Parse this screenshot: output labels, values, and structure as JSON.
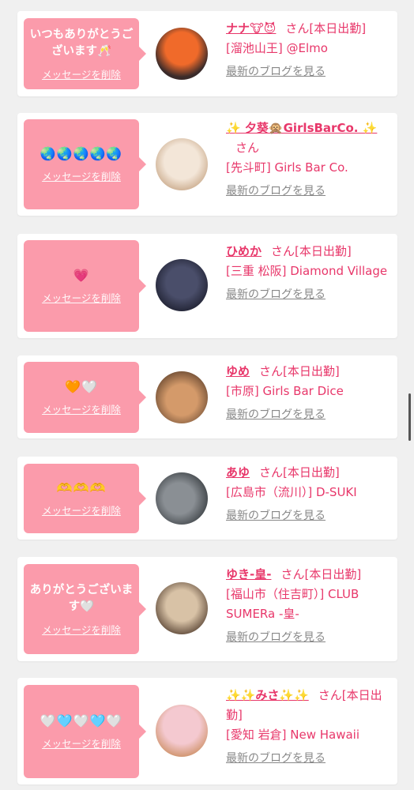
{
  "cards": [
    {
      "message": "いつもありがとうございます🥂",
      "delete_label": "メッセージを削除",
      "name": "ナナ🐮😈",
      "honorific": "さん",
      "status": "[本日出勤]",
      "shop": "[溜池山王] @Elmo",
      "blog_label": "最新のブログを見る",
      "avatar_colors": [
        "#f06a2a",
        "#3a2b2a"
      ]
    },
    {
      "message": "🌏🌏🌏🌏🌏",
      "delete_label": "メッセージを削除",
      "name": "✨ 夕葵🙊GirlsBarCo. ✨",
      "honorific": "さん",
      "status": "",
      "shop": "[先斗町] Girls Bar Co.",
      "blog_label": "最新のブログを見る",
      "avatar_colors": [
        "#f3e6d8",
        "#c9a98a"
      ]
    },
    {
      "message": "💗",
      "delete_label": "メッセージを削除",
      "name": "ひめか",
      "honorific": "さん",
      "status": "[本日出勤]",
      "shop": "[三重 松阪] Diamond Village",
      "blog_label": "最新のブログを見る",
      "avatar_colors": [
        "#4a4e6a",
        "#1e2030"
      ]
    },
    {
      "message": "🧡🤍",
      "delete_label": "メッセージを削除",
      "name": "ゆめ",
      "honorific": "さん",
      "status": "[本日出勤]",
      "shop": "[市原] Girls Bar Dice",
      "blog_label": "最新のブログを見る",
      "avatar_colors": [
        "#d49a6a",
        "#6b4a32"
      ]
    },
    {
      "message": "🫶🫶🫶",
      "delete_label": "メッセージを削除",
      "name": "あゆ",
      "honorific": "さん",
      "status": "[本日出勤]",
      "shop": "[広島市（流川）] D-SUKI",
      "blog_label": "最新のブログを見る",
      "avatar_colors": [
        "#8a8f94",
        "#3d4246"
      ]
    },
    {
      "message": "ありがとうございます🤍",
      "delete_label": "メッセージを削除",
      "name": "ゆき-皇-",
      "honorific": "さん",
      "status": "[本日出勤]",
      "shop": "[福山市（住吉町）] CLUB SUMERa -皇-",
      "blog_label": "最新のブログを見る",
      "avatar_colors": [
        "#d8c2a6",
        "#5a4535"
      ]
    },
    {
      "message": "🤍🩵🤍🩵🤍",
      "delete_label": "メッセージを削除",
      "name": "✨✨みさ✨✨",
      "honorific": "さん",
      "status": "[本日出勤]",
      "shop": "[愛知 岩倉] New Hawaii",
      "blog_label": "最新のブログを見る",
      "avatar_colors": [
        "#f4c9d0",
        "#c98a5a"
      ]
    }
  ]
}
